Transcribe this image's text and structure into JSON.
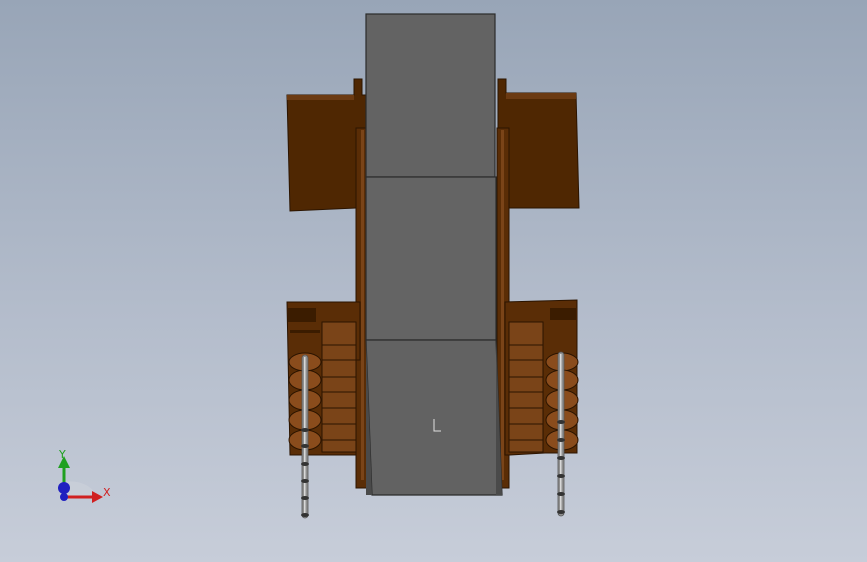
{
  "viewport": {
    "background_top": "#98a5b7",
    "background_bottom": "#c7cdd9"
  },
  "model": {
    "bobbin_color": "#4f2702",
    "bobbin_dark": "#3b1c00",
    "bobbin_light": "#7a4418",
    "core_color": "#626262",
    "core_edge": "#2b2b2b",
    "pin_color": "#8f8f8f",
    "pin_highlight": "#d8d8d8"
  },
  "triad": {
    "x_label": "X",
    "y_label": "Y",
    "x_color": "#d02020",
    "y_color": "#20a020",
    "z_color": "#2020c0"
  }
}
